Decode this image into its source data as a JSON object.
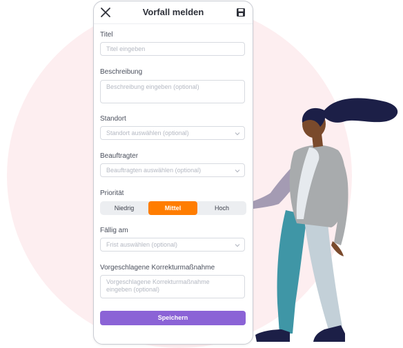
{
  "header": {
    "title": "Vorfall melden"
  },
  "form": {
    "title_label": "Titel",
    "title_placeholder": "Titel eingeben",
    "description_label": "Beschreibung",
    "description_placeholder": "Beschreibung eingeben (optional)",
    "location_label": "Standort",
    "location_placeholder": "Standort auswählen (optional)",
    "assignee_label": "Beauftragter",
    "assignee_placeholder": "Beauftragten auswählen (optional)",
    "priority_label": "Priorität",
    "priority_options": [
      "Niedrig",
      "Mittel",
      "Hoch"
    ],
    "priority_selected": "Mittel",
    "due_label": "Fällig am",
    "due_placeholder": "Frist auswählen (optional)",
    "action_label": "Vorgeschlagene Korrekturmaßnahme",
    "action_placeholder": "Vorgeschlagene Korrekturmaßnahme eingeben (optional)",
    "save_label": "Speichern"
  },
  "icons": {
    "close": "close-icon",
    "save": "floppy-disk-icon",
    "dropdown": "chevron-down-icon"
  },
  "colors": {
    "accent_orange": "#ff7d00",
    "primary_purple": "#8b63d6",
    "background_blob": "#fdeef0"
  }
}
